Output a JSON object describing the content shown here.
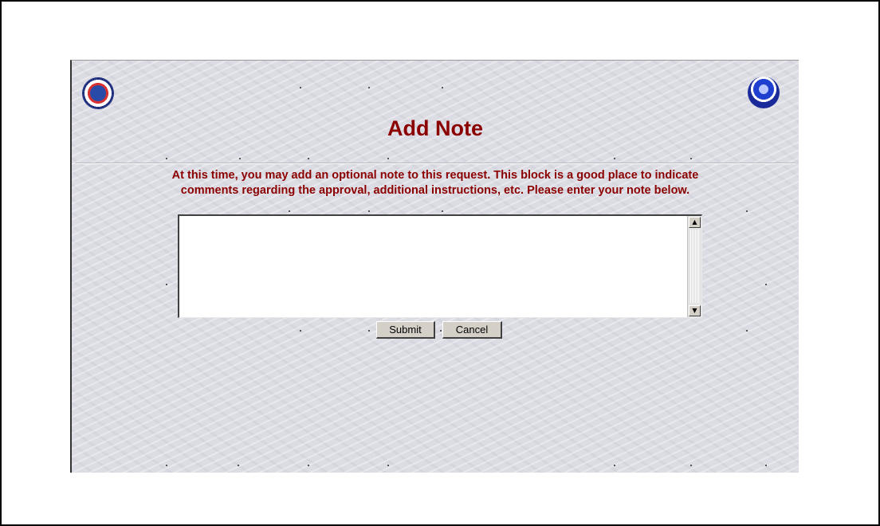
{
  "page": {
    "title": "Add Note",
    "instructions_line1": "At this time, you may add an optional note to this request. This block is a good place to indicate",
    "instructions_line2": "comments regarding the approval, additional instructions, etc. Please enter your note below.",
    "note_value": "",
    "submit_label": "Submit",
    "cancel_label": "Cancel"
  },
  "logos": {
    "left": "nws-logo-icon",
    "right": "noaa-logo-icon"
  },
  "scrollbar": {
    "up_glyph": "▲",
    "down_glyph": "▼"
  },
  "colors": {
    "heading": "#8b0000",
    "background": "#dcdce4"
  }
}
